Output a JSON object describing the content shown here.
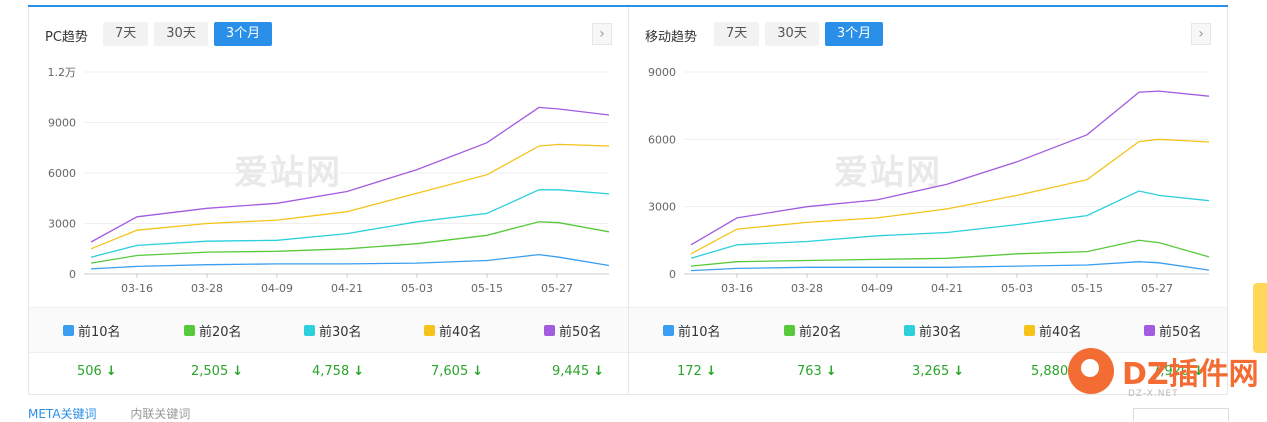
{
  "colors": {
    "top10": "#3a9ef0",
    "top20": "#58c93a",
    "top30": "#2bd0dc",
    "top40": "#f5c319",
    "top50": "#a35be0",
    "accent": "#2a8fe8",
    "down": "#2aa52a"
  },
  "tabs": [
    "7天",
    "30天",
    "3个月"
  ],
  "active_tab": "3个月",
  "next_icon": "chevron-right-icon",
  "watermark": "爱站网",
  "panels": {
    "pc": {
      "title": "PC趋势",
      "legend": [
        "前10名",
        "前20名",
        "前30名",
        "前40名",
        "前50名"
      ],
      "values": [
        "506",
        "2,505",
        "4,758",
        "7,605",
        "9,445"
      ]
    },
    "mobile": {
      "title": "移动趋势",
      "legend": [
        "前10名",
        "前20名",
        "前30名",
        "前40名",
        "前50名"
      ],
      "values": [
        "172",
        "763",
        "3,265",
        "5,880",
        "7,920"
      ]
    }
  },
  "chart_data": [
    {
      "type": "line",
      "title": "PC趋势",
      "y_ticks": [
        "0",
        "3000",
        "6000",
        "9000",
        "1.2万"
      ],
      "ylim": [
        0,
        12000
      ],
      "x_ticks": [
        "03-16",
        "03-28",
        "04-09",
        "04-21",
        "05-03",
        "05-15",
        "05-27"
      ],
      "x": [
        "03-06",
        "03-16",
        "03-28",
        "04-09",
        "04-21",
        "05-03",
        "05-15",
        "05-22",
        "05-27",
        "06-01"
      ],
      "series": [
        {
          "name": "前10名",
          "values": [
            300,
            450,
            550,
            600,
            600,
            650,
            800,
            1150,
            1000,
            506
          ]
        },
        {
          "name": "前20名",
          "values": [
            650,
            1100,
            1300,
            1350,
            1500,
            1800,
            2300,
            3100,
            3050,
            2505
          ]
        },
        {
          "name": "前30名",
          "values": [
            1000,
            1700,
            1950,
            2000,
            2400,
            3100,
            3600,
            5000,
            5000,
            4758
          ]
        },
        {
          "name": "前40名",
          "values": [
            1500,
            2600,
            3000,
            3200,
            3700,
            4800,
            5900,
            7600,
            7700,
            7605
          ]
        },
        {
          "name": "前50名",
          "values": [
            1900,
            3400,
            3900,
            4200,
            4900,
            6200,
            7800,
            9900,
            9800,
            9445
          ]
        }
      ],
      "grid": true,
      "legend": "bottom"
    },
    {
      "type": "line",
      "title": "移动趋势",
      "y_ticks": [
        "0",
        "3000",
        "6000",
        "9000"
      ],
      "ylim": [
        0,
        9000
      ],
      "x_ticks": [
        "03-16",
        "03-28",
        "04-09",
        "04-21",
        "05-03",
        "05-15",
        "05-27"
      ],
      "x": [
        "03-06",
        "03-16",
        "03-28",
        "04-09",
        "04-21",
        "05-03",
        "05-15",
        "05-22",
        "05-27",
        "06-01"
      ],
      "series": [
        {
          "name": "前10名",
          "values": [
            150,
            250,
            300,
            300,
            300,
            350,
            400,
            550,
            500,
            172
          ]
        },
        {
          "name": "前20名",
          "values": [
            350,
            550,
            600,
            650,
            700,
            900,
            1000,
            1500,
            1400,
            763
          ]
        },
        {
          "name": "前30名",
          "values": [
            700,
            1300,
            1450,
            1700,
            1850,
            2200,
            2600,
            3700,
            3500,
            3265
          ]
        },
        {
          "name": "前40名",
          "values": [
            900,
            2000,
            2300,
            2500,
            2900,
            3500,
            4200,
            5900,
            6000,
            5880
          ]
        },
        {
          "name": "前50名",
          "values": [
            1300,
            2500,
            3000,
            3300,
            4000,
            5000,
            6200,
            8100,
            8150,
            7920
          ]
        }
      ],
      "grid": true,
      "legend": "bottom"
    }
  ],
  "footer": {
    "items": [
      "META关键词",
      "内联关键词"
    ]
  },
  "logo": {
    "text": "DZ插件网",
    "sub": "DZ-X.NET"
  }
}
